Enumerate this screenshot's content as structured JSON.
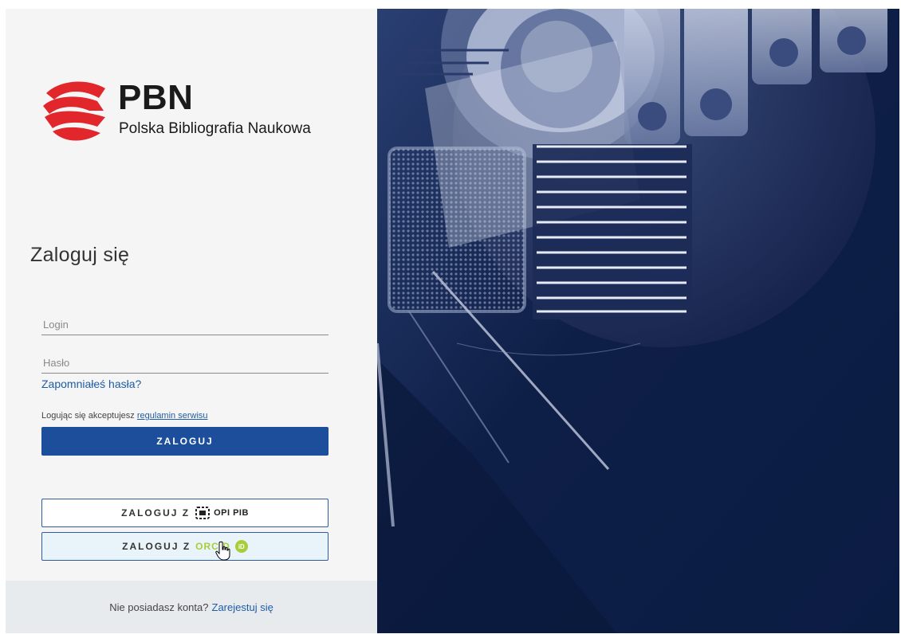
{
  "logo": {
    "name": "PBN",
    "subtitle": "Polska Bibliografia Naukowa"
  },
  "login": {
    "title": "Zaloguj się",
    "login_placeholder": "Login",
    "password_placeholder": "Hasło",
    "forgot_password": "Zapomniałeś hasła?",
    "terms_prefix": "Logując się akceptujesz",
    "terms_link": "regulamin serwisu",
    "submit_label": "ZALOGUJ"
  },
  "sso": {
    "opi_prefix": "ZALOGUJ Z",
    "opi_brand": "OPI PIB",
    "orcid_prefix": "ZALOGUJ Z",
    "orcid_brand": "ORCID",
    "orcid_badge": "iD"
  },
  "footer": {
    "prompt": "Nie posiadasz konta?",
    "register_link": "Zarejestuj się"
  },
  "colors": {
    "primary": "#1c4e9b",
    "link": "#1e5ca6",
    "logo_red": "#e1262c",
    "orcid_green": "#a6ce39",
    "panel_navy": "#0d2148"
  },
  "icons": {
    "logo": "pbn-logo-icon",
    "opi": "opi-pib-logo-icon",
    "orcid": "orcid-id-icon",
    "cursor": "hand-pointer-icon"
  }
}
